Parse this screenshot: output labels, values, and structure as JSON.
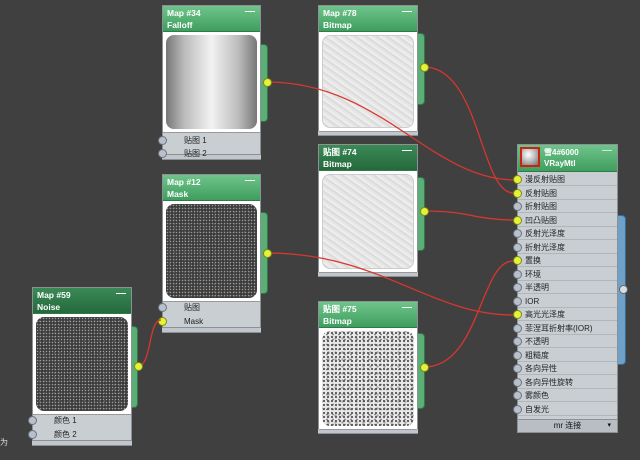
{
  "nodes": {
    "map34": {
      "id": "Map #34",
      "type": "Falloff",
      "slots": [
        "贴图 1",
        "贴图 2"
      ]
    },
    "map78": {
      "id": "Map #78",
      "type": "Bitmap"
    },
    "map12": {
      "id": "Map #12",
      "type": "Mask",
      "slots": [
        "贴图",
        "Mask"
      ]
    },
    "map74": {
      "id": "贴图 #74",
      "type": "Bitmap"
    },
    "map75": {
      "id": "贴图 #75",
      "type": "Bitmap"
    },
    "map59": {
      "id": "Map #59",
      "type": "Noise",
      "slots": [
        "颜色 1",
        "颜色 2"
      ]
    }
  },
  "material": {
    "name": "雪4#6000",
    "type": "VRayMtl",
    "slots": [
      "漫反射贴图",
      "反射贴图",
      "折射贴图",
      "凹凸贴图",
      "反射光泽度",
      "折射光泽度",
      "置换",
      "环境",
      "半透明",
      "IOR",
      "高光光泽度",
      "菲涅耳折射率(IOR)",
      "不透明",
      "粗糙度",
      "各向异性",
      "各向异性旋转",
      "雾颜色",
      "自发光"
    ],
    "footer": "mr 连接"
  },
  "edge_text": "为",
  "minimize_glyph": "—",
  "icons": {
    "expand": "chevron-down-icon"
  },
  "colors": {
    "wire": "#d8362e",
    "node_header": "#3f9e5f",
    "socket_active": "#e5f23a"
  }
}
